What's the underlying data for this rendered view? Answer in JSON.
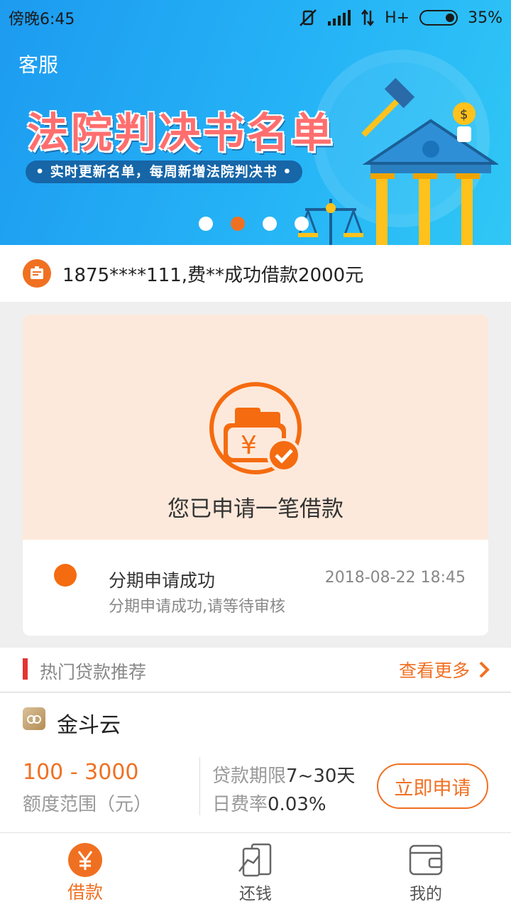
{
  "status_bar": {
    "time": "傍晚6:45",
    "network": "H+",
    "battery": "35%",
    "battery_level": 0.35
  },
  "banner": {
    "customer_service": "客服",
    "title": "法院判决书名单",
    "subtitle": "• 实时更新名单，每周新增法院判决书 •",
    "page_count": 4,
    "active_page": 2
  },
  "notice": {
    "text": "1875****111,费**成功借款2000元"
  },
  "loan_card": {
    "status": "您已申请一笔借款",
    "step_title": "分期申请成功",
    "step_time": "2018-08-22 18:45",
    "step_desc": "分期申请成功,请等待审核"
  },
  "hot_loans": {
    "title": "热门贷款推荐",
    "more_label": "查看更多",
    "product": {
      "name": "金斗云",
      "amount_range": "100 - 3000",
      "amount_label": "额度范围（元）",
      "term_label": "贷款期限",
      "term_value": "7~30天",
      "rate_label": "日费率",
      "rate_value": "0.03%",
      "apply_label": "立即申请"
    }
  },
  "tabbar": {
    "items": [
      {
        "label": "借款",
        "icon": "yuan-icon",
        "active": true
      },
      {
        "label": "还钱",
        "icon": "repay-icon",
        "active": false
      },
      {
        "label": "我的",
        "icon": "wallet-icon",
        "active": false
      }
    ]
  },
  "colors": {
    "accent": "#f07022",
    "banner_blue": "#1d9bf0",
    "card_bg": "#fde9db",
    "red_bar": "#e53333"
  }
}
